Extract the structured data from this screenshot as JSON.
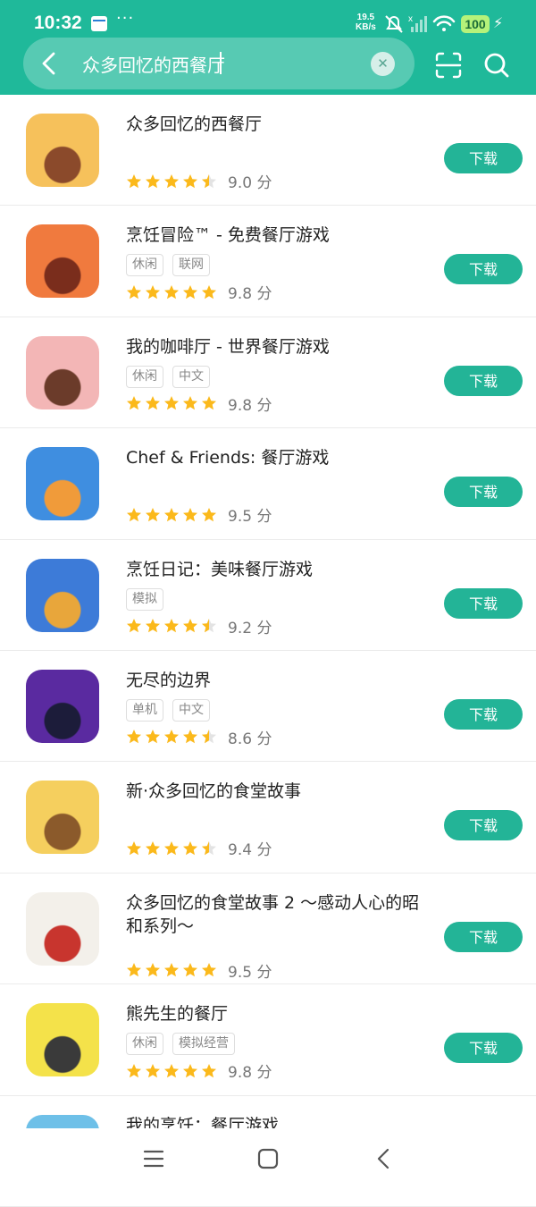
{
  "status_bar": {
    "time": "10:32",
    "dots": "···",
    "net_speed_value": "19.5",
    "net_speed_unit": "KB/s",
    "battery": "100"
  },
  "search": {
    "query": "众多回忆的西餐厅"
  },
  "apps": [
    {
      "title": "众多回忆的西餐厅",
      "tags": [],
      "score": "9.0 分",
      "stars": 4.5,
      "download": "下载",
      "icon_colors": [
        "#f6c15b",
        "#8b4a2b"
      ]
    },
    {
      "title": "烹饪冒险™ - 免费餐厅游戏",
      "tags": [
        "休闲",
        "联网"
      ],
      "score": "9.8 分",
      "stars": 5,
      "download": "下载",
      "icon_colors": [
        "#f07a3e",
        "#7a2d1c"
      ]
    },
    {
      "title": "我的咖啡厅 - 世界餐厅游戏",
      "tags": [
        "休闲",
        "中文"
      ],
      "score": "9.8 分",
      "stars": 5,
      "download": "下载",
      "icon_colors": [
        "#f3b6b6",
        "#6b3b2a"
      ]
    },
    {
      "title": "Chef & Friends: 餐厅游戏",
      "tags": [],
      "score": "9.5 分",
      "stars": 5,
      "download": "下载",
      "icon_colors": [
        "#3f8ee0",
        "#f09b3a"
      ]
    },
    {
      "title": "烹饪日记：美味餐厅游戏",
      "tags": [
        "模拟"
      ],
      "score": "9.2 分",
      "stars": 4.5,
      "download": "下载",
      "icon_colors": [
        "#3d7bd8",
        "#e8a63b"
      ]
    },
    {
      "title": "无尽的边界",
      "tags": [
        "单机",
        "中文"
      ],
      "score": "8.6 分",
      "stars": 4.5,
      "download": "下载",
      "icon_colors": [
        "#5a2aa0",
        "#1c1c3a"
      ]
    },
    {
      "title": "新·众多回忆的食堂故事",
      "tags": [],
      "score": "9.4 分",
      "stars": 4.5,
      "download": "下载",
      "icon_colors": [
        "#f5cf5e",
        "#8b5a2b"
      ]
    },
    {
      "title": "众多回忆的食堂故事 2 ～感动人心的昭和系列～",
      "tags": [],
      "score": "9.5 分",
      "stars": 5,
      "download": "下载",
      "icon_colors": [
        "#f3f0ea",
        "#c8352e"
      ]
    },
    {
      "title": "熊先生的餐厅",
      "tags": [
        "休闲",
        "模拟经营"
      ],
      "score": "9.8 分",
      "stars": 5,
      "download": "下载",
      "icon_colors": [
        "#f4e24a",
        "#3a3a3a"
      ]
    },
    {
      "title": "我的烹饪：餐厅游戏",
      "tags": [],
      "score": "",
      "stars": 0,
      "download": "",
      "icon_colors": [
        "#6ec0e8",
        "#e07a5a"
      ]
    }
  ],
  "colors": {
    "accent": "#1fb99a",
    "button": "#23b497",
    "star": "#fbb91b"
  }
}
